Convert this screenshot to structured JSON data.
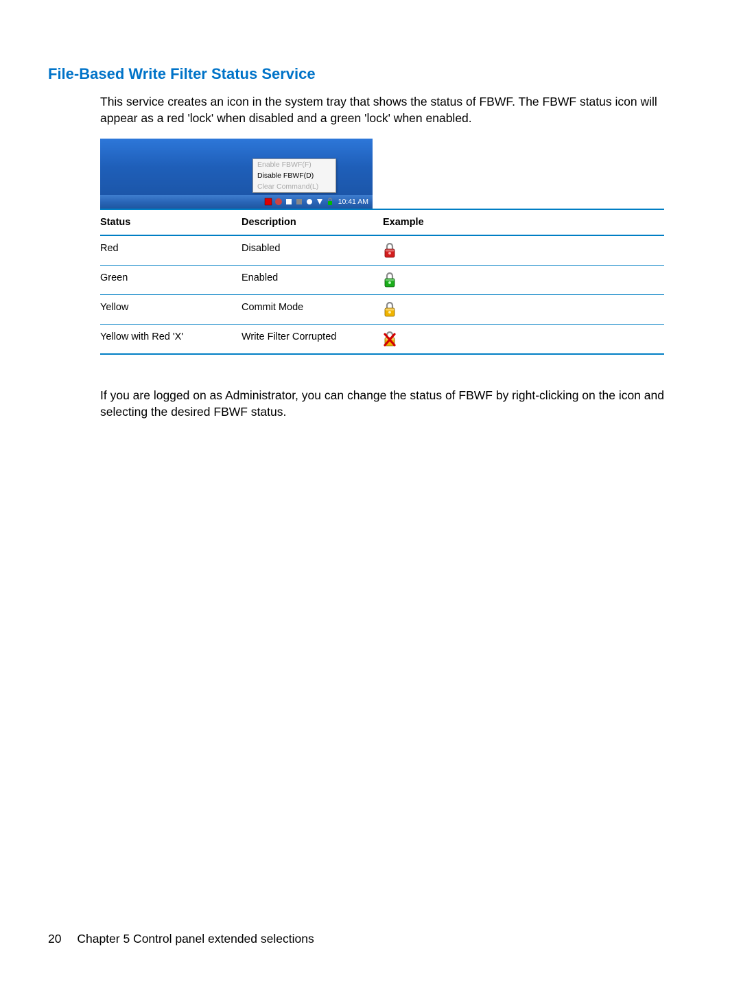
{
  "heading": "File-Based Write Filter Status Service",
  "intro_text": "This service creates an icon in the system tray that shows the status of FBWF. The FBWF status icon will appear as a red 'lock' when disabled and a green 'lock' when enabled.",
  "context_menu": {
    "enable": "Enable FBWF(F)",
    "disable": "Disable FBWF(D)",
    "clear": "Clear Command(L)"
  },
  "clock_time": "10:41 AM",
  "table": {
    "headers": {
      "status": "Status",
      "description": "Description",
      "example": "Example"
    },
    "rows": [
      {
        "status": "Red",
        "description": "Disabled",
        "icon": "red"
      },
      {
        "status": "Green",
        "description": "Enabled",
        "icon": "green"
      },
      {
        "status": "Yellow",
        "description": "Commit Mode",
        "icon": "yellow"
      },
      {
        "status": "Yellow with Red 'X'",
        "description": "Write Filter Corrupted",
        "icon": "yellow-x"
      }
    ]
  },
  "outro_text": "If you are logged on as Administrator, you can change the status of FBWF by right-clicking on the icon and selecting the desired FBWF status.",
  "footer": {
    "page_number": "20",
    "chapter": "Chapter 5   Control panel extended selections"
  }
}
